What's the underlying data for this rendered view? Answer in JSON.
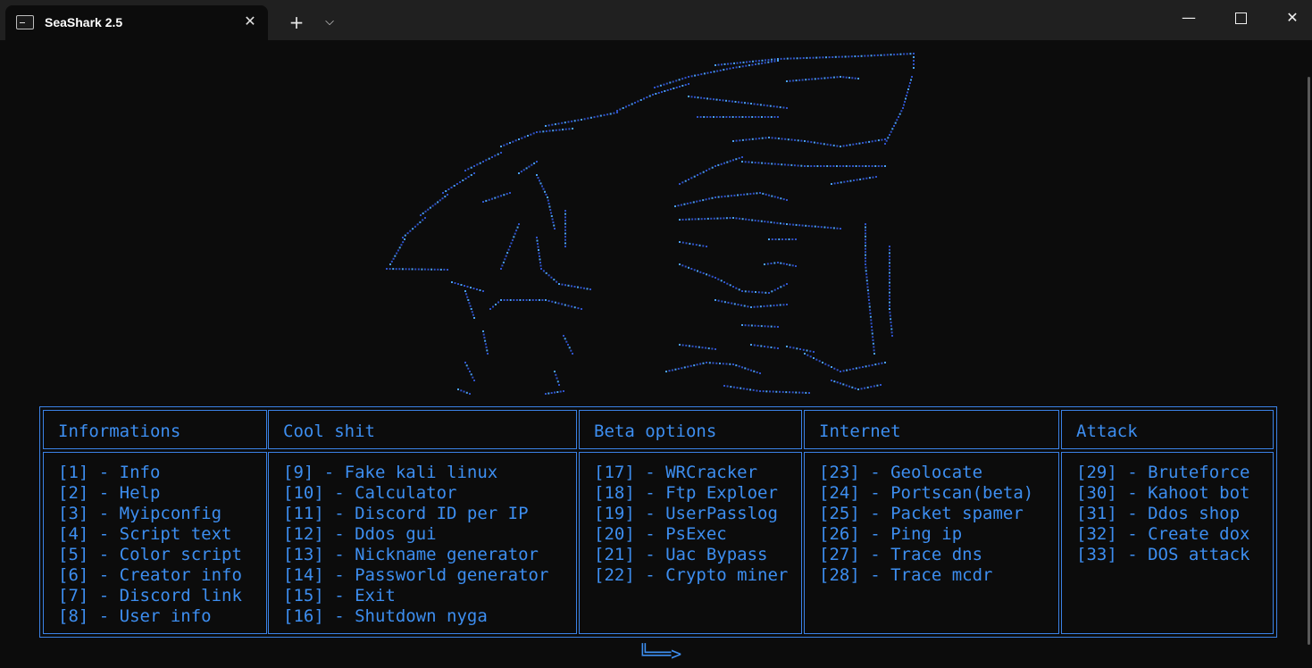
{
  "window": {
    "tab_title": "SeaShark 2.5",
    "new_tab_glyph": "+",
    "dropdown_glyph": "⌵",
    "close_tab_glyph": "✕",
    "minimize_glyph": "—",
    "close_glyph": "✕"
  },
  "colors": {
    "accent": "#3d8ef0",
    "art_dark": "#2f52c8",
    "art_light": "#4aa0f0",
    "background": "#0c0c0c",
    "titlebar": "#202020"
  },
  "menu": {
    "columns": [
      {
        "header": "Informations",
        "items": [
          "[1] - Info",
          "[2] - Help",
          "[3] - Myipconfig",
          "[4] - Script text",
          "[5] - Color script",
          "[6] - Creator info",
          "[7] - Discord link",
          "[8] - User info"
        ]
      },
      {
        "header": "Cool shit",
        "items": [
          "[9] - Fake kali linux",
          "[10] - Calculator",
          "[11] - Discord ID per IP",
          "[12] - Ddos gui",
          "[13] - Nickname generator",
          "[14] - Passworld generator",
          "[15] - Exit",
          "[16] - Shutdown nyga"
        ]
      },
      {
        "header": "Beta options",
        "items": [
          "[17] - WRCracker",
          "[18] - Ftp Exploer",
          "[19] - UserPasslog",
          "[20] - PsExec",
          "[21] - Uac Bypass",
          "[22] - Crypto miner"
        ]
      },
      {
        "header": "Internet",
        "items": [
          "[23] - Geolocate",
          "[24] - Portscan(beta)",
          "[25] - Packet spamer",
          "[26] - Ping ip",
          "[27] - Trace dns",
          "[28] - Trace mcdr"
        ]
      },
      {
        "header": "Attack",
        "items": [
          "[29] - Bruteforce",
          "[30] - Kahoot bot",
          "[31] - Ddos shop",
          "[32] - Create dox",
          "[33] - DOS attack"
        ]
      }
    ]
  },
  "prompt": {
    "arrow": "╚══>"
  }
}
